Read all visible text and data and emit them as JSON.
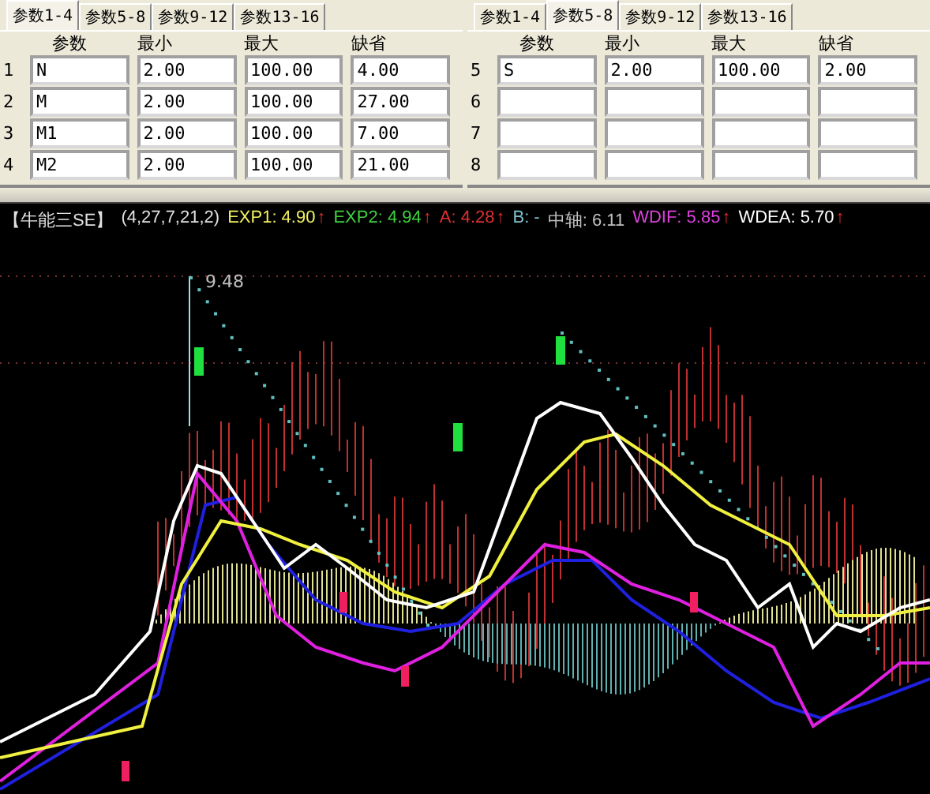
{
  "param_panels": [
    {
      "tabs": [
        {
          "label": "参数1-4",
          "selected": true
        },
        {
          "label": "参数5-8",
          "selected": false
        },
        {
          "label": "参数9-12",
          "selected": false
        },
        {
          "label": "参数13-16",
          "selected": false
        }
      ],
      "columns": [
        "参数",
        "最小",
        "最大",
        "缺省"
      ],
      "rows": [
        {
          "number": "1",
          "cells": [
            "N",
            "2.00",
            "100.00",
            "4.00"
          ]
        },
        {
          "number": "2",
          "cells": [
            "M",
            "2.00",
            "100.00",
            "27.00"
          ]
        },
        {
          "number": "3",
          "cells": [
            "M1",
            "2.00",
            "100.00",
            "7.00"
          ]
        },
        {
          "number": "4",
          "cells": [
            "M2",
            "2.00",
            "100.00",
            "21.00"
          ]
        }
      ]
    },
    {
      "tabs": [
        {
          "label": "参数1-4",
          "selected": false
        },
        {
          "label": "参数5-8",
          "selected": true
        },
        {
          "label": "参数9-12",
          "selected": false
        },
        {
          "label": "参数13-16",
          "selected": false
        }
      ],
      "columns": [
        "参数",
        "最小",
        "最大",
        "缺省"
      ],
      "rows": [
        {
          "number": "5",
          "cells": [
            "S",
            "2.00",
            "100.00",
            "2.00"
          ]
        },
        {
          "number": "6"
        },
        {
          "number": "7"
        },
        {
          "number": "8"
        }
      ]
    }
  ],
  "chart": {
    "title": "【牛能三SE】",
    "params": "(4,27,7,21,2)",
    "legend": [
      {
        "text": "EXP1: 4.90",
        "color": "#f0f060",
        "arrow": "↑"
      },
      {
        "text": "EXP2: 4.94",
        "color": "#40d040",
        "arrow": "↑"
      },
      {
        "text": "A: 4.28",
        "color": "#e03030",
        "arrow": "↑"
      },
      {
        "text": "B: -",
        "color": "#80c0d0"
      },
      {
        "text": "中轴: 6.11",
        "color": "#c0c0c0"
      },
      {
        "text": "WDIF: 5.85",
        "color": "#e040e0",
        "arrow": "↑"
      },
      {
        "text": "WDEA: 5.70",
        "color": "#ffffff",
        "arrow": "↑"
      }
    ],
    "peak_label": "9.48"
  }
}
